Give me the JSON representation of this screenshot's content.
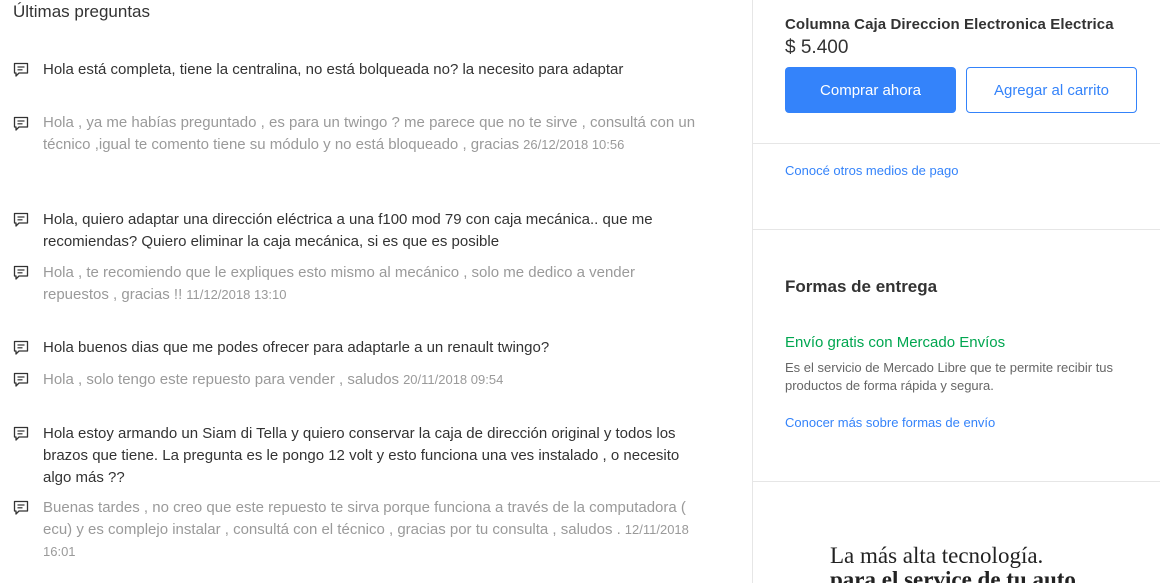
{
  "questions_section": {
    "title": "Últimas preguntas",
    "items": [
      {
        "question": "Hola está completa, tiene la centralina, no está bolqueada no? la necesito para adaptar",
        "answer": "Hola , ya me habías preguntado , es para un twingo ? me parece que no te sirve , consultá con un técnico ,igual te comento tiene su módulo y no está bloqueado , gracias",
        "date": "26/12/2018 10:56"
      },
      {
        "question": "Hola, quiero adaptar una dirección eléctrica a una f100 mod 79 con caja mecánica.. que me recomiendas? Quiero eliminar la caja mecánica, si es que es posible",
        "answer": "Hola , te recomiendo que le expliques esto mismo al mecánico , solo me dedico a vender repuestos , gracias !!",
        "date": "11/12/2018 13:10"
      },
      {
        "question": "Hola buenos dias que me podes ofrecer para adaptarle a un renault twingo?",
        "answer": "Hola , solo tengo este repuesto para vender , saludos",
        "date": "20/11/2018 09:54"
      },
      {
        "question": "Hola estoy armando un Siam di Tella y quiero conservar la caja de dirección original y todos los brazos que tiene. La pregunta es le pongo 12 volt y esto funciona una ves instalado , o necesito algo más ??",
        "answer": "Buenas tardes , no creo que este repuesto te sirva porque funciona a través de la computadora ( ecu) y es complejo instalar , consultá con el técnico , gracias por tu consulta , saludos .",
        "date": "12/11/2018 16:01"
      }
    ]
  },
  "product": {
    "title": "Columna Caja Direccion Electronica Electrica",
    "price": "$ 5.400",
    "buy_label": "Comprar ahora",
    "cart_label": "Agregar al carrito",
    "payment_link": "Conocé otros medios de pago"
  },
  "shipping": {
    "title": "Formas de entrega",
    "free_label": "Envío gratis con Mercado Envíos",
    "description": "Es el servicio de Mercado Libre que te permite recibir tus productos de forma rápida y segura.",
    "more_link": "Conocer más sobre formas de envío"
  },
  "ad": {
    "line1": "La más alta tecnología.",
    "line2": "para el service de tu auto"
  },
  "icons": {
    "question": "chat-bubble-icon",
    "answer": "chat-bubble-icon"
  },
  "colors": {
    "accent": "#3483fa",
    "free_shipping": "#00a650",
    "answer_text": "#9a9a9a"
  }
}
